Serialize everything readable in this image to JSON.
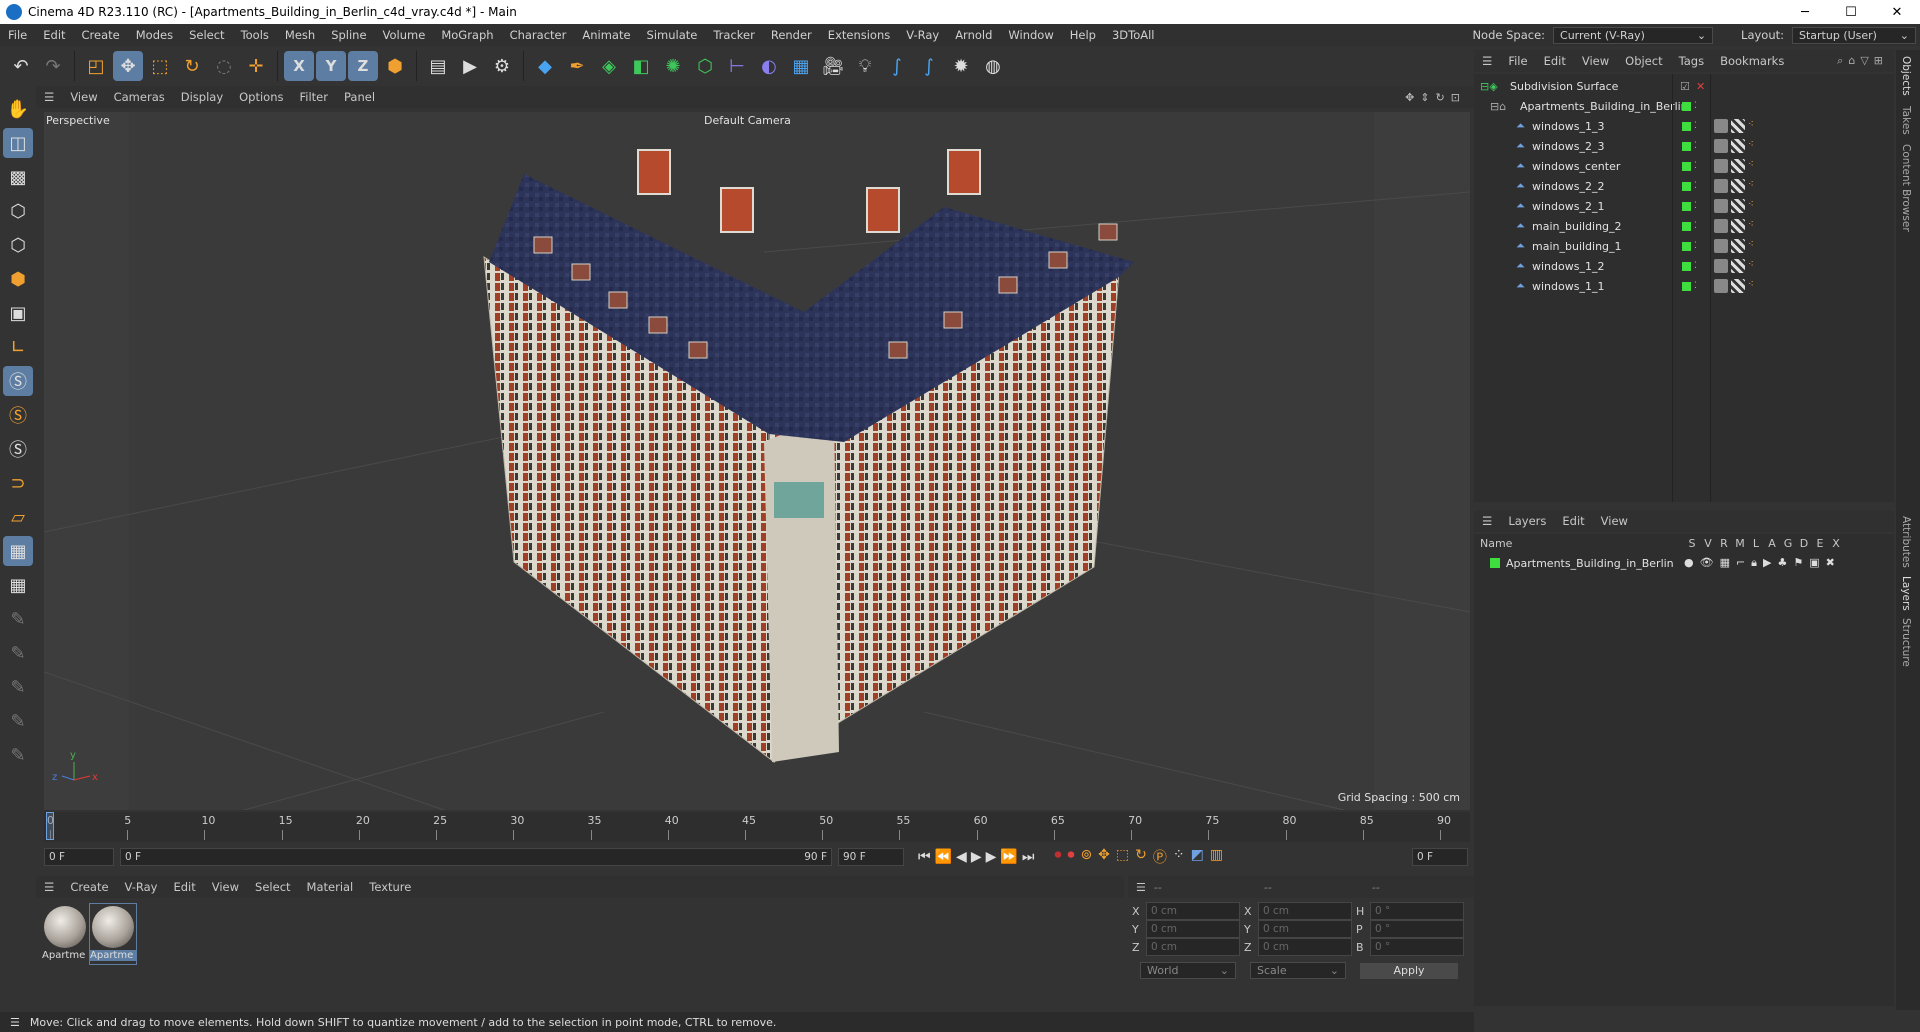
{
  "window": {
    "title": "Cinema 4D R23.110 (RC) - [Apartments_Building_in_Berlin_c4d_vray.c4d *] - Main",
    "controls": [
      "─",
      "☐",
      "✕"
    ]
  },
  "menubar": {
    "items": [
      "File",
      "Edit",
      "Create",
      "Modes",
      "Select",
      "Tools",
      "Mesh",
      "Spline",
      "Volume",
      "MoGraph",
      "Character",
      "Animate",
      "Simulate",
      "Tracker",
      "Render",
      "Extensions",
      "V-Ray",
      "Arnold",
      "Window",
      "Help",
      "3DToAll"
    ],
    "node_space_label": "Node Space:",
    "node_space_value": "Current (V-Ray)",
    "layout_label": "Layout:",
    "layout_value": "Startup (User)"
  },
  "toolbar": {
    "icons": [
      "undo-icon",
      "redo-icon",
      "live-selection-icon",
      "move-icon",
      "scale-icon",
      "rotate-icon",
      "recent-tools-icon",
      "add-icon",
      "x-axis-icon",
      "y-axis-icon",
      "z-axis-icon",
      "coordinate-system-icon",
      "render-region-icon",
      "render-view-icon",
      "render-settings-icon",
      "cube-icon",
      "pen-icon",
      "subdivision-icon",
      "extrude-icon",
      "cloner-icon",
      "voronoi-icon",
      "symmetry-icon",
      "deformer-icon",
      "floor-icon",
      "camera-icon",
      "light-icon",
      "python-icon",
      "python-2-icon",
      "settings-icon",
      "vray-globe-icon"
    ],
    "axis_labels": [
      "X",
      "Y",
      "Z"
    ]
  },
  "viewport": {
    "menu": [
      "View",
      "Cameras",
      "Display",
      "Options",
      "Filter",
      "Panel"
    ],
    "label": "Perspective",
    "camera": "Default Camera",
    "grid_spacing": "Grid Spacing : 500 cm"
  },
  "timeline": {
    "ticks": [
      "0",
      "5",
      "10",
      "15",
      "20",
      "25",
      "30",
      "35",
      "40",
      "45",
      "50",
      "55",
      "60",
      "65",
      "70",
      "75",
      "80",
      "85",
      "90"
    ],
    "current_frame": "0 F",
    "start_frame": "0 F",
    "range_start": "0 F",
    "range_end": "90 F",
    "end_frame": "90 F",
    "right_frame": "0 F"
  },
  "material_manager": {
    "menu": [
      "Create",
      "V-Ray",
      "Edit",
      "View",
      "Select",
      "Material",
      "Texture"
    ],
    "materials": [
      "Apartme",
      "Apartme"
    ]
  },
  "coordinates": {
    "headers": [
      "--",
      "--",
      "--"
    ],
    "rows": [
      {
        "a": "X",
        "av": "0 cm",
        "b": "X",
        "bv": "0 cm",
        "c": "H",
        "cv": "0 °"
      },
      {
        "a": "Y",
        "av": "0 cm",
        "b": "Y",
        "bv": "0 cm",
        "c": "P",
        "cv": "0 °"
      },
      {
        "a": "Z",
        "av": "0 cm",
        "b": "Z",
        "bv": "0 cm",
        "c": "B",
        "cv": "0 °"
      }
    ],
    "space": "World",
    "mode": "Scale",
    "apply": "Apply"
  },
  "status": "Move: Click and drag to move elements. Hold down SHIFT to quantize movement / add to the selection in point mode, CTRL to remove.",
  "object_manager": {
    "menu": [
      "File",
      "Edit",
      "View",
      "Object",
      "Tags",
      "Bookmarks"
    ],
    "root": "Subdivision Surface",
    "group": "Apartments_Building_in_Berlin",
    "objects": [
      "windows_1_3",
      "windows_2_3",
      "windows_center",
      "windows_2_2",
      "windows_2_1",
      "main_building_2",
      "main_building_1",
      "windows_1_2",
      "windows_1_1"
    ]
  },
  "layer_manager": {
    "menu": [
      "Layers",
      "Edit",
      "View"
    ],
    "columns": [
      "Name",
      "S",
      "V",
      "R",
      "M",
      "L",
      "A",
      "G",
      "D",
      "E",
      "X"
    ],
    "layers": [
      "Apartments_Building_in_Berlin"
    ]
  },
  "side_tabs": [
    "Objects",
    "Takes",
    "Content Browser",
    "Attributes",
    "Layers",
    "Structure"
  ],
  "colors": {
    "accent": "#5d7da3",
    "visible_green": "#3ede3e",
    "roof": "#2e3558",
    "brick": "#a8442a",
    "facade": "#d9d4c9"
  }
}
